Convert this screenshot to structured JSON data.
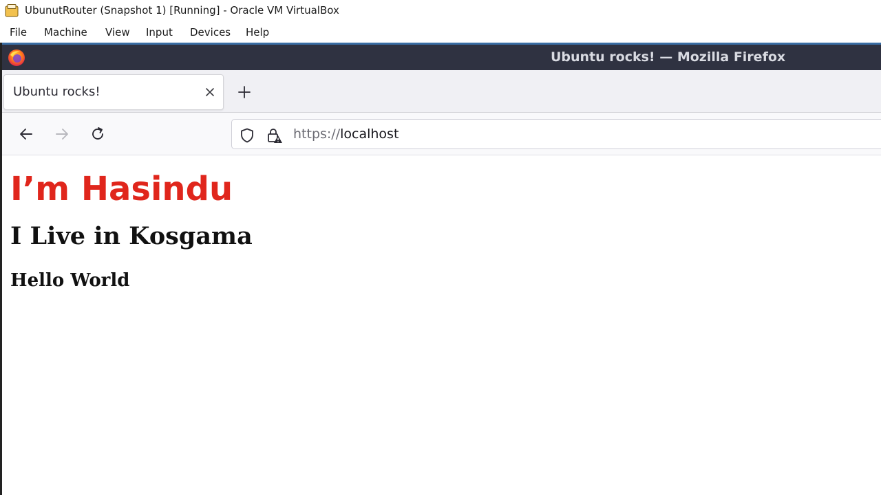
{
  "vbox": {
    "title": "UbunutRouter (Snapshot 1) [Running] - Oracle VM VirtualBox",
    "menu": [
      "File",
      "Machine",
      "View",
      "Input",
      "Devices",
      "Help"
    ],
    "app_icon": "virtualbox-icon"
  },
  "firefox": {
    "window_title": "Ubuntu rocks! — Mozilla Firefox",
    "logo_icon": "firefox-logo-icon",
    "tab": {
      "label": "Ubuntu rocks!",
      "close_icon": "close-icon"
    },
    "new_tab_icon": "plus-icon",
    "nav": {
      "back_icon": "arrow-left-icon",
      "forward_icon": "arrow-right-icon",
      "reload_icon": "reload-icon"
    },
    "urlbar": {
      "shield_icon": "tracking-protection-shield-icon",
      "lock_icon": "lock-warning-icon",
      "scheme": "https://",
      "host": "localhost"
    }
  },
  "page": {
    "heading1": "I’m Hasindu",
    "heading2": "I Live in Kosgama",
    "heading3": "Hello World"
  },
  "colors": {
    "heading1": "#e0261c",
    "firefox_titlebar": "#2f3241",
    "accent": "#3a6ea5"
  }
}
